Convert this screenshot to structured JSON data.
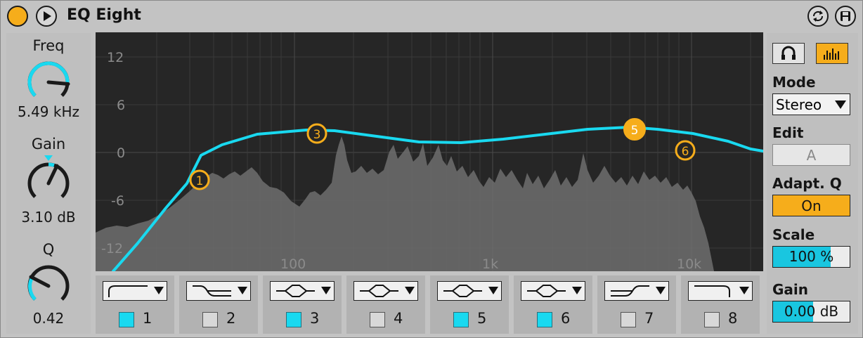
{
  "device": {
    "title": "EQ Eight",
    "icons": {
      "power": "power-icon",
      "play": "play-icon",
      "hotswap": "hotswap-icon",
      "save": "save-icon"
    }
  },
  "knobs": {
    "freq": {
      "label": "Freq",
      "value": "5.49 kHz"
    },
    "gain": {
      "label": "Gain",
      "value": "3.10 dB"
    },
    "q": {
      "label": "Q",
      "value": "0.42"
    }
  },
  "graph": {
    "db_ticks": [
      "12",
      "6",
      "0",
      "-6",
      "-12"
    ],
    "freq_ticks": [
      "100",
      "1k",
      "10k"
    ],
    "curve_color": "#19d9f0",
    "marker_color": "#f6ad1b",
    "markers": [
      {
        "label": "1",
        "filled": false
      },
      {
        "label": "3",
        "filled": false
      },
      {
        "label": "5",
        "filled": true
      },
      {
        "label": "6",
        "filled": false
      }
    ]
  },
  "bands": [
    {
      "num": "1",
      "shape": "low-cut-icon",
      "active": true
    },
    {
      "num": "2",
      "shape": "low-shelf-icon",
      "active": false
    },
    {
      "num": "3",
      "shape": "bell-icon",
      "active": true
    },
    {
      "num": "4",
      "shape": "bell-icon",
      "active": false
    },
    {
      "num": "5",
      "shape": "bell-icon",
      "active": true
    },
    {
      "num": "6",
      "shape": "bell-icon",
      "active": true
    },
    {
      "num": "7",
      "shape": "high-shelf-icon",
      "active": false
    },
    {
      "num": "8",
      "shape": "high-cut-icon",
      "active": false
    }
  ],
  "right": {
    "mode_label": "Mode",
    "mode_value": "Stereo",
    "edit_label": "Edit",
    "edit_value": "A",
    "adaptq_label": "Adapt. Q",
    "adaptq_value": "On",
    "scale_label": "Scale",
    "scale_value": "100 %",
    "scale_fill": 0.75,
    "gain_label": "Gain",
    "gain_value": "0.00 dB",
    "gain_fill": 0.52,
    "accent": "#f6ad1b",
    "cyan": "#19c6e0"
  }
}
